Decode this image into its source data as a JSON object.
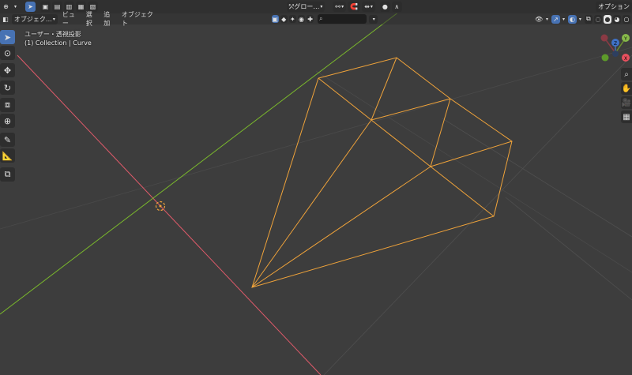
{
  "header": {
    "mode_label": "オブジェク…",
    "menus": [
      "ビュー",
      "選択",
      "追加",
      "オブジェクト"
    ],
    "orientation_label": "グロー…",
    "options_label": "オプション"
  },
  "filter": {
    "search_placeholder": ""
  },
  "viewport": {
    "view_name": "ユーザー・透視投影",
    "collection_info": "(1) Collection | Curve"
  },
  "gizmo": {
    "x_label": "X",
    "y_label": "Y",
    "z_label": "Z"
  },
  "colors": {
    "background": "#3d3d3d",
    "x_axis": "#e05a6a",
    "y_axis": "#7ab82c",
    "selected_wire": "#f0a33a",
    "active_button": "#4772b3"
  },
  "icons": {
    "tools": [
      "cursor-select-icon",
      "3d-cursor-icon",
      "move-icon",
      "rotate-icon",
      "scale-icon",
      "transform-icon",
      "annotate-icon",
      "measure-icon",
      "add-cube-icon"
    ],
    "nav": [
      "zoom-icon",
      "pan-hand-icon",
      "camera-icon",
      "grid-view-icon"
    ]
  }
}
